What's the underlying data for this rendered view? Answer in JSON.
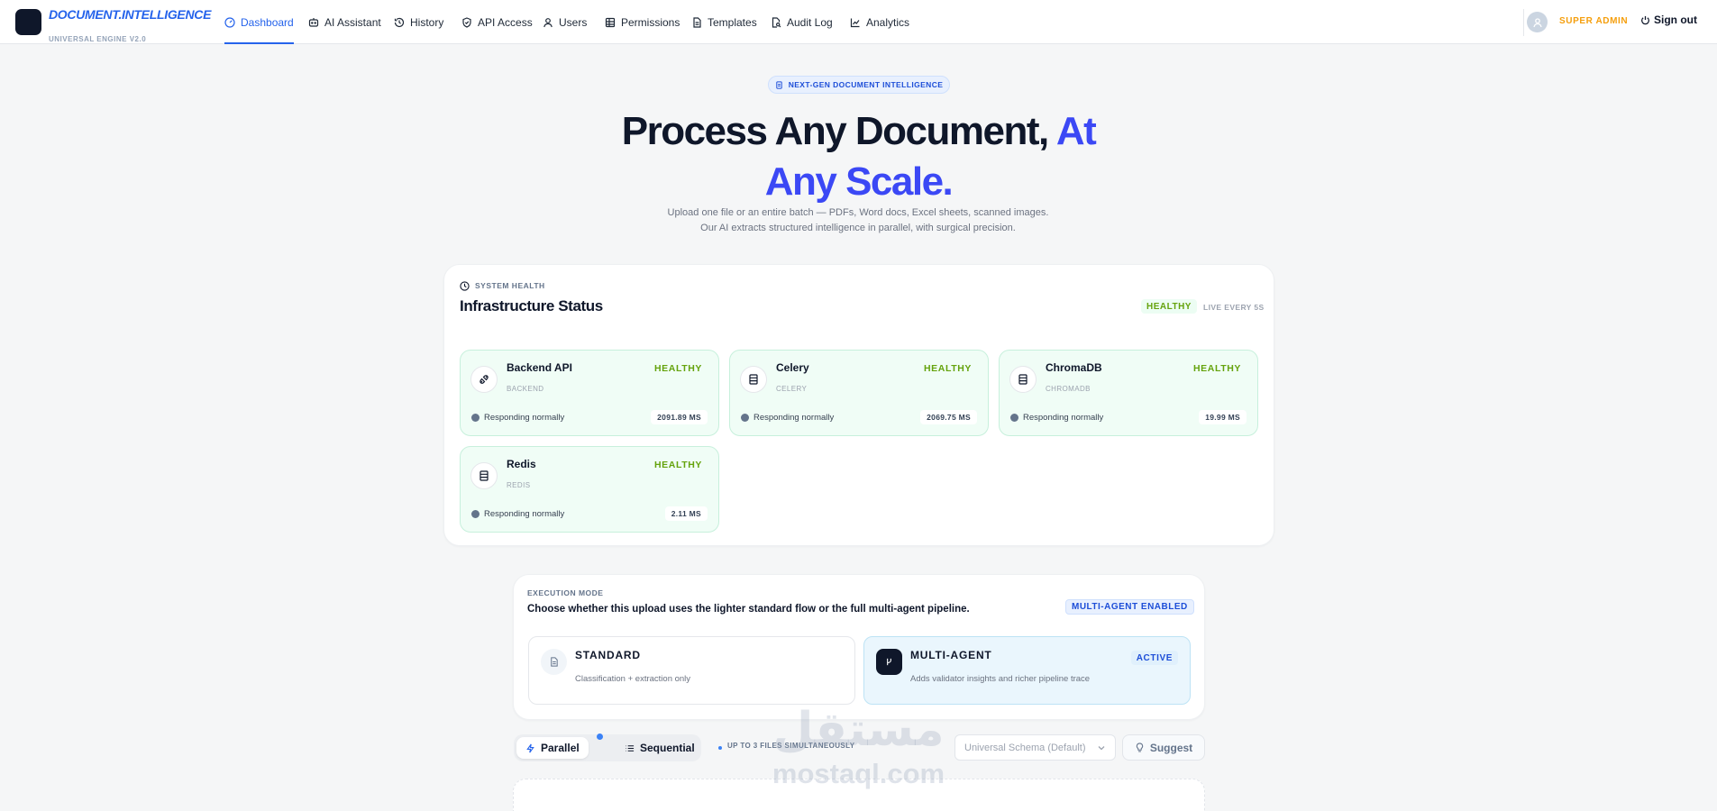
{
  "header": {
    "brand": {
      "name": "DOCUMENT.INTELLIGENCE",
      "subtitle": "UNIVERSAL ENGINE V2.0"
    },
    "nav": [
      {
        "label": "Dashboard",
        "icon": "gauge-icon",
        "active": true
      },
      {
        "label": "AI Assistant",
        "icon": "bot-icon",
        "active": false
      },
      {
        "label": "History",
        "icon": "history-icon",
        "active": false
      },
      {
        "label": "API Access",
        "icon": "shield-icon",
        "active": false
      },
      {
        "label": "Users",
        "icon": "user-icon",
        "active": false
      },
      {
        "label": "Permissions",
        "icon": "grid-icon",
        "active": false
      },
      {
        "label": "Templates",
        "icon": "file-icon",
        "active": false
      },
      {
        "label": "Audit Log",
        "icon": "file-search-icon",
        "active": false
      },
      {
        "label": "Analytics",
        "icon": "chart-line-icon",
        "active": false
      }
    ],
    "role": "SUPER ADMIN",
    "signout": "Sign out"
  },
  "hero": {
    "badge": "NEXT-GEN DOCUMENT INTELLIGENCE",
    "title_dark": "Process Any Document, ",
    "title_accent_1": "At",
    "title_accent_2": "Any Scale.",
    "description": "Upload one file or an entire batch — PDFs, Word docs, Excel sheets, scanned images. Our AI extracts structured intelligence in parallel, with surgical precision."
  },
  "infrastructure": {
    "eyebrow": "SYSTEM HEALTH",
    "title": "Infrastructure Status",
    "overall_status": "HEALTHY",
    "refresh_note": "LIVE EVERY 5S",
    "services": [
      {
        "name": "Backend API",
        "key": "BACKEND",
        "status": "HEALTHY",
        "note": "Responding normally",
        "latency": "2091.89 MS",
        "icon": "plug-icon"
      },
      {
        "name": "Celery",
        "key": "CELERY",
        "status": "HEALTHY",
        "note": "Responding normally",
        "latency": "2069.75 MS",
        "icon": "server-icon"
      },
      {
        "name": "ChromaDB",
        "key": "CHROMADB",
        "status": "HEALTHY",
        "note": "Responding normally",
        "latency": "19.99 MS",
        "icon": "database-icon"
      },
      {
        "name": "Redis",
        "key": "REDIS",
        "status": "HEALTHY",
        "note": "Responding normally",
        "latency": "2.11 MS",
        "icon": "server-icon"
      }
    ]
  },
  "execution": {
    "eyebrow": "EXECUTION MODE",
    "prompt": "Choose whether this upload uses the lighter standard flow or the full multi-agent pipeline.",
    "badge": "MULTI-AGENT ENABLED",
    "modes": [
      {
        "title": "STANDARD",
        "description": "Classification + extraction only",
        "active": false
      },
      {
        "title": "MULTI-AGENT",
        "description": "Adds validator insights and richer pipeline trace",
        "active": true,
        "active_label": "ACTIVE"
      }
    ]
  },
  "toolbar": {
    "parallel_label": "Parallel",
    "sequential_label": "Sequential",
    "parallel_hint": "UP TO 3 FILES SIMULTANEOUSLY",
    "schema_placeholder": "Universal Schema (Default)",
    "suggest_label": "Suggest"
  },
  "watermark": {
    "arabic": "مستقل",
    "latin": "mostaql.com"
  },
  "colors": {
    "accent": "#2563eb",
    "title_accent": "#3b48f5",
    "healthy": "#65a30d",
    "role": "#f59e0b"
  }
}
